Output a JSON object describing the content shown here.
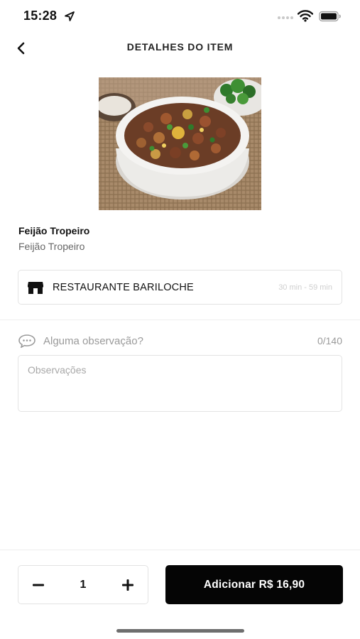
{
  "status_bar": {
    "time": "15:28",
    "icons": [
      "location-arrow-icon",
      "signal-dots-icon",
      "wifi-icon",
      "battery-icon"
    ]
  },
  "header": {
    "title": "DETALHES DO ITEM",
    "back_icon": "chevron-left-icon"
  },
  "item": {
    "name": "Feijão Tropeiro",
    "description": "Feijão Tropeiro",
    "image_icon": "food-photo"
  },
  "restaurant": {
    "name": "RESTAURANTE BARILOCHE",
    "delivery_time": "30 min - 59 min",
    "icon": "store-icon"
  },
  "observations": {
    "label": "Alguma observação?",
    "counter": "0/140",
    "placeholder": "Observações",
    "value": "",
    "icon": "chat-bubble-icon"
  },
  "footer": {
    "quantity": "1",
    "minus_icon": "minus-icon",
    "plus_icon": "plus-icon",
    "add_label": "Adicionar R$ 16,90"
  },
  "colors": {
    "primary": "#050505",
    "border": "#e3e3e3",
    "muted_text": "#9a9a9a",
    "background": "#ffffff"
  }
}
